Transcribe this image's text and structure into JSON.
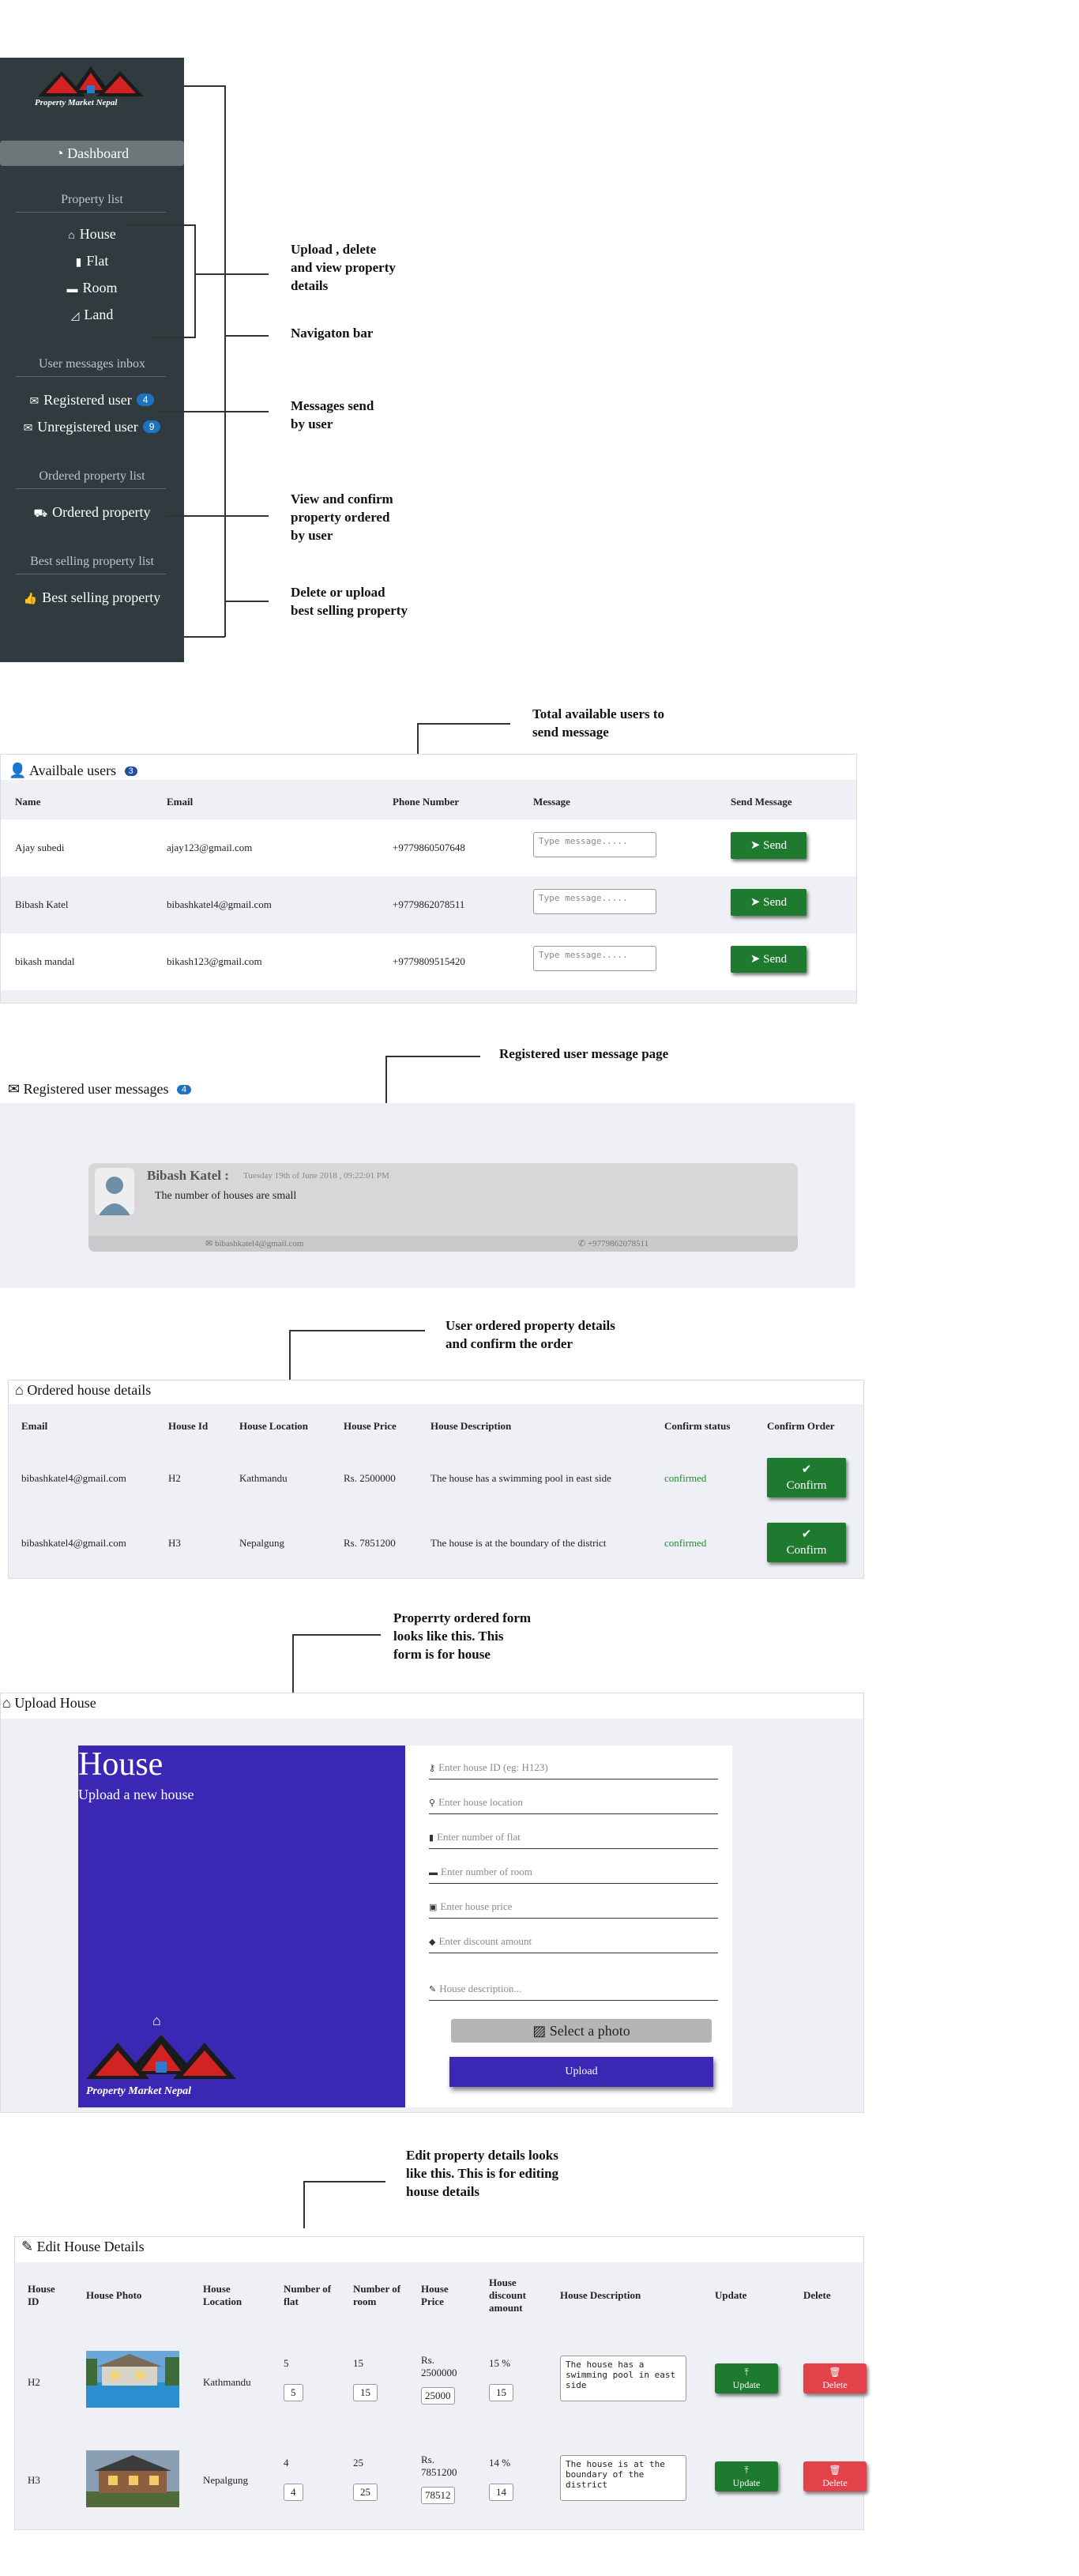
{
  "sidebar": {
    "brand_text": "Property Market Nepal",
    "dashboard": "Dashboard",
    "sections": {
      "property_list": "Property list",
      "messages": "User messages inbox",
      "ordered": "Ordered property list",
      "best": "Best selling property list"
    },
    "nav": {
      "house": "House",
      "flat": "Flat",
      "room": "Room",
      "land": "Land",
      "registered_user": "Registered user",
      "registered_count": "4",
      "unregistered_user": "Unregistered user",
      "unregistered_count": "9",
      "ordered_property": "Ordered property",
      "best_selling_property": "Best selling property"
    }
  },
  "annotations": {
    "upload": "Upload , delete\nand view property\ndetails",
    "navbar": "Navigaton bar",
    "messages": "Messages send\nby user",
    "ordered": "View and confirm\nproperty ordered\nby user",
    "best": "Delete or upload\nbest selling property",
    "users": "Total available users to\nsend message",
    "reg_msg": "Registered user message page",
    "ordered_details": "User ordered property details\nand confirm  the order",
    "form": "Properrty ordered form\nlooks like this. This\nform is for house",
    "edit": "Edit property details looks\nlike this. This is for editing\nhouse details"
  },
  "users_panel": {
    "title": "Availbale users",
    "count": "3",
    "headers": [
      "Name",
      "Email",
      "Phone Number",
      "Message",
      "Send Message"
    ],
    "placeholder": "Type message.....",
    "send_label": "Send",
    "rows": [
      {
        "name": "Ajay subedi",
        "email": "ajay123@gmail.com",
        "phone": "+9779860507648"
      },
      {
        "name": "Bibash Katel",
        "email": "bibashkatel4@gmail.com",
        "phone": "+9779862078511"
      },
      {
        "name": "bikash mandal",
        "email": "bikash123@gmail.com",
        "phone": "+9779809515420"
      }
    ]
  },
  "reg_messages": {
    "title": "Registered user messages",
    "count": "4",
    "sender": "Bibash Katel :",
    "date": "Tuesday 19th of June 2018 , 09:22:01 PM",
    "message": "The number of houses are small",
    "email": "bibashkatel4@gmail.com",
    "phone": "+9779862078511"
  },
  "ordered_panel": {
    "title": "Ordered house details",
    "headers": [
      "Email",
      "House Id",
      "House Location",
      "House Price",
      "House Description",
      "Confirm status",
      "Confirm Order"
    ],
    "confirm_label": "Confirm",
    "rows": [
      {
        "email": "bibashkatel4@gmail.com",
        "id": "H2",
        "location": "Kathmandu",
        "price": "Rs. 2500000",
        "desc": "The house has a swimming pool in east side",
        "status": "confirmed"
      },
      {
        "email": "bibashkatel4@gmail.com",
        "id": "H3",
        "location": "Nepalgung",
        "price": "Rs. 7851200",
        "desc": "The house is at the boundary of the district",
        "status": "confirmed"
      }
    ]
  },
  "upload_panel": {
    "title": "Upload House",
    "hero_title": "House",
    "hero_sub": "Upload a new house",
    "brand_text": "Property Market Nepal",
    "fields": [
      "Enter house ID (eg: H123)",
      "Enter house location",
      "Enter number of flat",
      "Enter number of room",
      "Enter house price",
      "Enter discount amount"
    ],
    "description_placeholder": "House description...",
    "photo_label": "Select a photo",
    "upload_label": "Upload",
    "accent": "#3a28b5"
  },
  "edit_panel": {
    "title": "Edit House Details",
    "headers": [
      "House ID",
      "House Photo",
      "House Location",
      "Number of flat",
      "Number of room",
      "House Price",
      "House discount amount",
      "House Description",
      "Update",
      "Delete"
    ],
    "update_label": "Update",
    "delete_label": "Delete",
    "rows": [
      {
        "id": "H2",
        "location": "Kathmandu",
        "flat": "5",
        "room": "15",
        "price": "Rs. 2500000",
        "price_input": "25000",
        "discount": "15 %",
        "discount_input": "15",
        "desc": "The house has a swimming pool in east side"
      },
      {
        "id": "H3",
        "location": "Nepalgung",
        "flat": "4",
        "room": "25",
        "price": "Rs. 7851200",
        "price_input": "78512",
        "discount": "14 %",
        "discount_input": "14",
        "desc": "The house is at the boundary of the district"
      }
    ]
  }
}
